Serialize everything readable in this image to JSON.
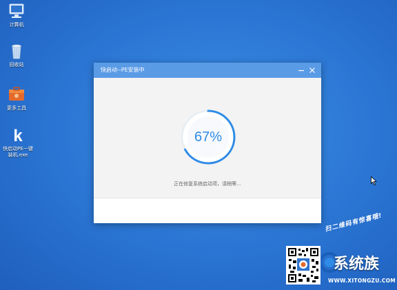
{
  "desktop": {
    "icons": [
      {
        "label": "计算机",
        "icon": "computer-icon"
      },
      {
        "label": "回收站",
        "icon": "recycle-bin-icon"
      },
      {
        "label": "更多工具",
        "icon": "toolbox-icon"
      },
      {
        "label": "快启动PE一键装机.exe",
        "label_lines": [
          "快启动PE一键",
          "装机.exe"
        ],
        "icon": "kqd-app-icon"
      }
    ]
  },
  "window": {
    "title": "快启动--PE安装中",
    "minimize_icon": "minimize-icon",
    "close_icon": "close-icon",
    "progress": {
      "percent": 67,
      "label": "67%"
    },
    "status": "正在修复系统启动项，请稍等..."
  },
  "colors": {
    "desktop_bg": "#2a74d2",
    "titlebar": "#5a9be6",
    "progress": "#2f8be6",
    "body_bg": "#f3f3f3"
  },
  "overlay": {
    "promo_text": "扫二维码有惊喜哦!",
    "site_name": "系统族",
    "site_url": "WWW.XITONGZU.COM"
  }
}
